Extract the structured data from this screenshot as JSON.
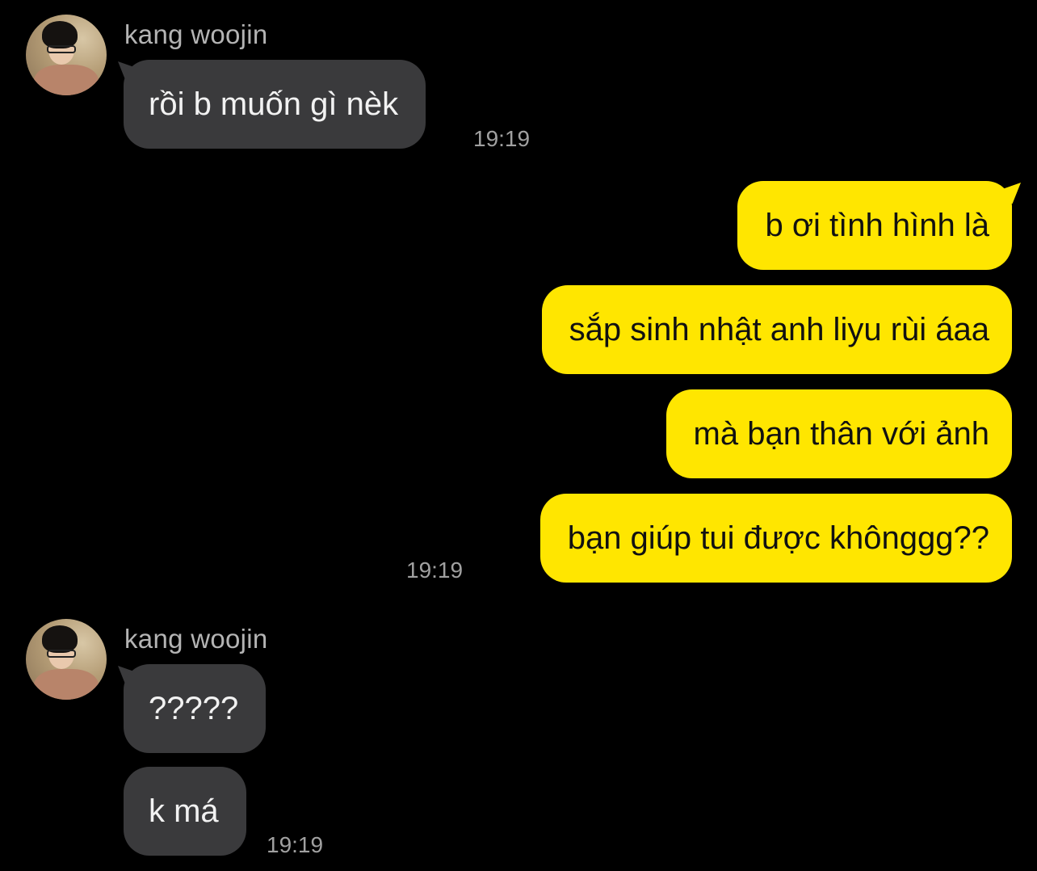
{
  "messages": [
    {
      "sender": "kang woojin",
      "text": "rồi b muốn gì nèk",
      "time": "19:19"
    },
    {
      "text": "b ơi tình hình là"
    },
    {
      "text": "sắp sinh nhật anh liyu rùi áaa"
    },
    {
      "text": "mà bạn thân với ảnh"
    },
    {
      "text": "bạn giúp tui được khônggg??",
      "time": "19:19"
    },
    {
      "sender": "kang woojin",
      "text": "?????"
    },
    {
      "text": "k má",
      "time": "19:19"
    }
  ],
  "colors": {
    "background": "#000000",
    "incoming_bubble": "#3a3a3c",
    "outgoing_bubble": "#ffe600",
    "sender_text": "#b4b4b4",
    "timestamp_text": "#a0a0a0"
  },
  "icons": [
    "avatar-kang-woojin"
  ]
}
